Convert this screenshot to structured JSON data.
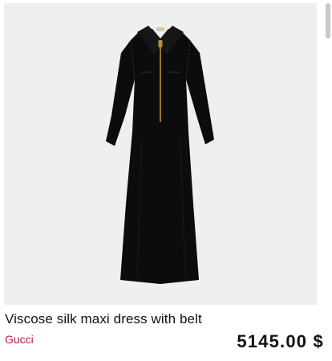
{
  "product": {
    "title": "Viscose silk maxi dress with belt",
    "brand": "Gucci",
    "price": "5145.00 $",
    "image": {
      "background_color": "#efefef",
      "garment_color": "#0c0c0c",
      "zipper_color": "#b8923a",
      "label_color": "#d8c7a8"
    }
  },
  "colors": {
    "brand_link": "#c2185b",
    "text": "#111111"
  }
}
